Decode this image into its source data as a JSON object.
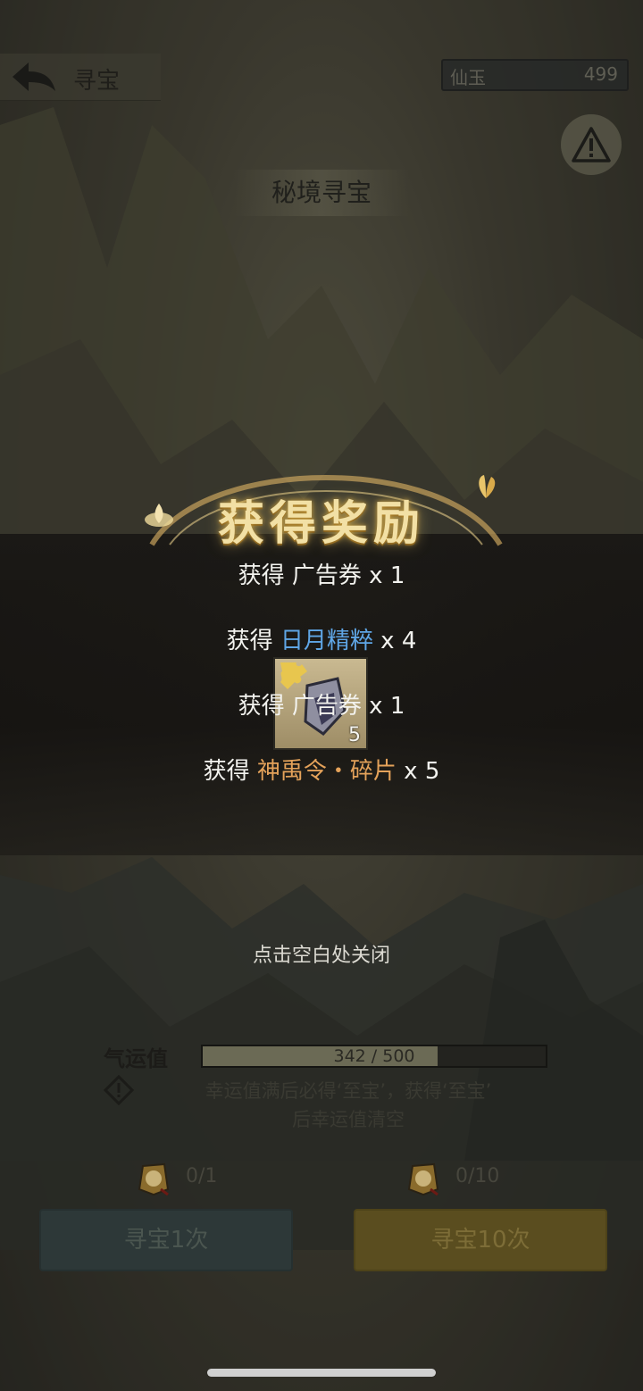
{
  "header": {
    "title": "寻宝",
    "currency_label": "仙玉",
    "currency_value": "499"
  },
  "section_title": "秘境寻宝",
  "reward": {
    "title": "获得奖励",
    "lines": [
      {
        "prefix": "获得",
        "name": "广告券",
        "qty": "x 1",
        "color": "#f3f3ef"
      },
      {
        "prefix": "获得",
        "name": "日月精粹",
        "qty": "x 4",
        "color": "#5fa6e6"
      },
      {
        "prefix": "获得",
        "name": "广告券",
        "qty": "x 1",
        "color": "#f3f3ef"
      },
      {
        "prefix": "获得",
        "name": "神禹令・碎片",
        "qty": "x 5",
        "color": "#e4a25a"
      }
    ],
    "item_count": "5"
  },
  "close_hint": "点击空白处关闭",
  "luck": {
    "label": "气运值",
    "current": 342,
    "max": 500,
    "text": "342 / 500",
    "note_line1": "幸运值满后必得‘至宝’，获得‘至宝’",
    "note_line2": "后幸运值清空"
  },
  "draw_one": {
    "count": "0/1",
    "label": "寻宝1次"
  },
  "draw_ten": {
    "count": "0/10",
    "label": "寻宝10次"
  }
}
